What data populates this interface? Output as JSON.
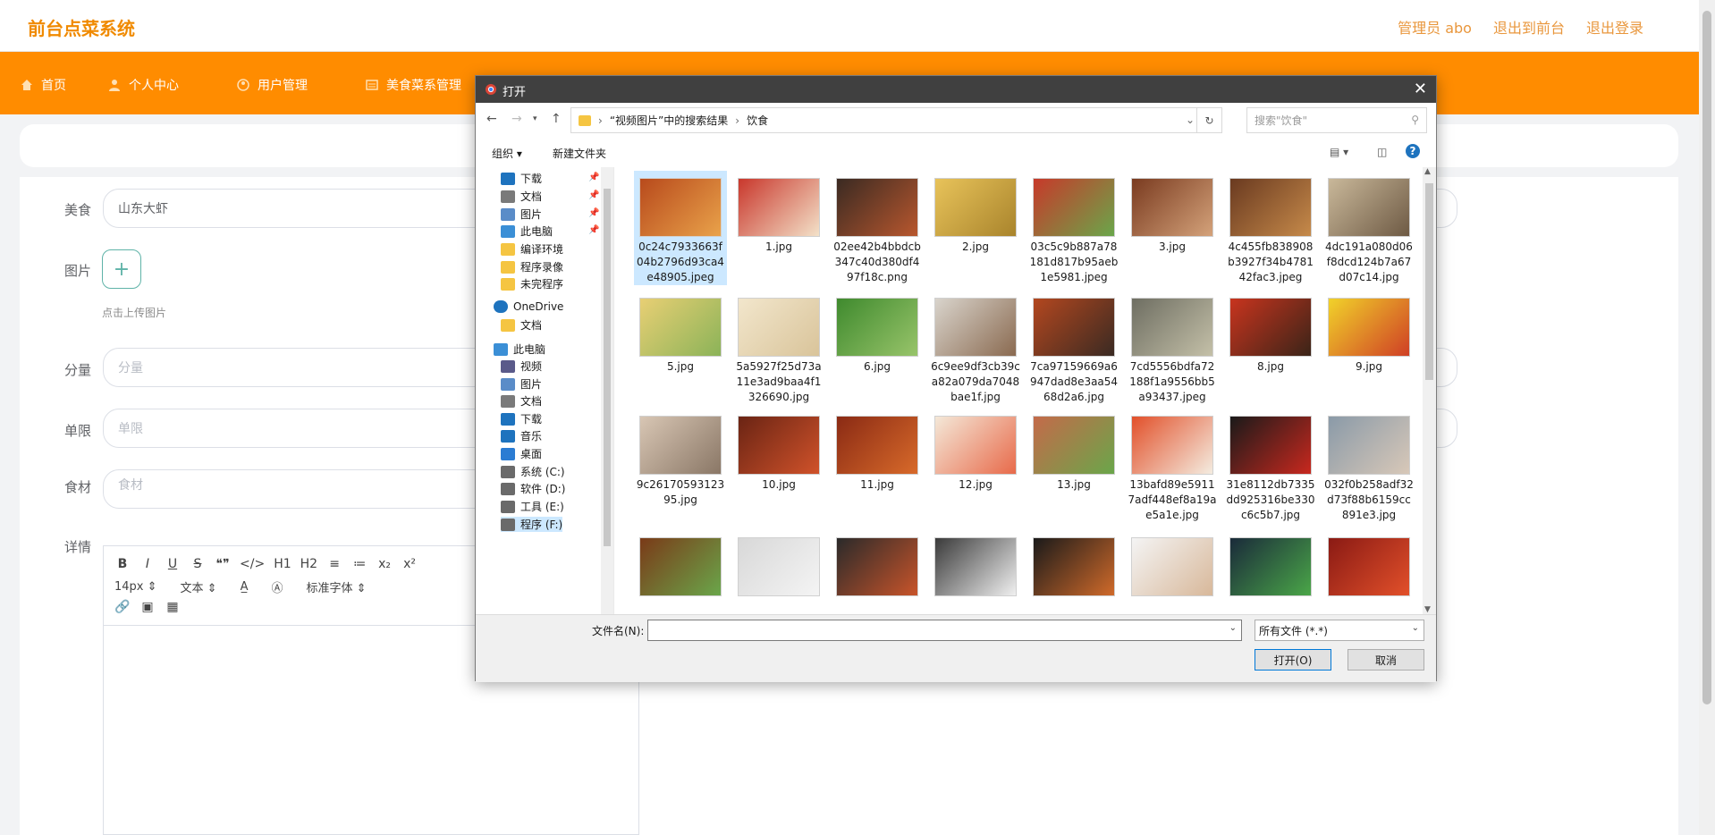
{
  "app": {
    "brand": "前台点菜系统",
    "top_links": {
      "admin": "管理员 abo",
      "back": "退出到前台",
      "logout": "退出登录"
    }
  },
  "nav": [
    {
      "label": "首页",
      "icon": "home-icon"
    },
    {
      "label": "个人中心",
      "icon": "user-icon"
    },
    {
      "label": "用户管理",
      "icon": "users-icon"
    },
    {
      "label": "美食菜系管理",
      "icon": "list-icon"
    }
  ],
  "form": {
    "food_label": "美食",
    "food_value": "山东大虾",
    "image_label": "图片",
    "upload_hint": "点击上传图片",
    "portion_label": "分量",
    "portion_placeholder": "分量",
    "limit_label": "单限",
    "limit_placeholder": "单限",
    "ingredient_label": "食材",
    "ingredient_placeholder": "食材",
    "detail_label": "详情"
  },
  "editor": {
    "toolbar_row1": [
      "B",
      "I",
      "U",
      "S",
      "❝❞",
      "</>",
      "H1",
      "H2",
      "≡",
      "≔",
      "x₂",
      "x²"
    ],
    "size": "14px",
    "text": "文本",
    "font": "标准字体"
  },
  "dialog": {
    "title": "打开",
    "breadcrumb": [
      "“视频图片”中的搜索结果",
      "饮食"
    ],
    "search_placeholder": "搜索\"饮食\"",
    "organize": "组织 ▾",
    "new_folder": "新建文件夹",
    "tree": [
      {
        "label": "下载",
        "icon": "download-icon",
        "pin": true
      },
      {
        "label": "文档",
        "icon": "document-icon",
        "pin": true
      },
      {
        "label": "图片",
        "icon": "picture-icon",
        "pin": true
      },
      {
        "label": "此电脑",
        "icon": "computer-icon",
        "pin": true
      },
      {
        "label": "编译环境",
        "icon": "folder-icon"
      },
      {
        "label": "程序录像",
        "icon": "folder-icon"
      },
      {
        "label": "未完程序",
        "icon": "folder-icon"
      },
      {
        "label": "OneDrive",
        "icon": "cloud-icon"
      },
      {
        "label": "文档",
        "icon": "folder-icon"
      },
      {
        "label": "此电脑",
        "icon": "computer-icon"
      },
      {
        "label": "视频",
        "icon": "video-icon"
      },
      {
        "label": "图片",
        "icon": "picture-icon"
      },
      {
        "label": "文档",
        "icon": "document-icon"
      },
      {
        "label": "下载",
        "icon": "download-icon"
      },
      {
        "label": "音乐",
        "icon": "music-icon"
      },
      {
        "label": "桌面",
        "icon": "desktop-icon"
      },
      {
        "label": "系统 (C:)",
        "icon": "drive-icon"
      },
      {
        "label": "软件 (D:)",
        "icon": "drive-icon"
      },
      {
        "label": "工具 (E:)",
        "icon": "drive-icon"
      },
      {
        "label": "程序 (F:)",
        "icon": "drive-icon"
      }
    ],
    "files": [
      {
        "name": "0c24c7933663f04b2796d93ca4e48905.jpeg",
        "c1": "#b84a1c",
        "c2": "#e9a24a"
      },
      {
        "name": "1.jpg",
        "c1": "#c9372c",
        "c2": "#f3e1c8"
      },
      {
        "name": "02ee42b4bbdcb347c40d380df497f18c.png",
        "c1": "#3a2a22",
        "c2": "#b8572e"
      },
      {
        "name": "2.jpg",
        "c1": "#e8c35a",
        "c2": "#a9842c"
      },
      {
        "name": "03c5c9b887a78181d817b95aeb1e5981.jpeg",
        "c1": "#c7392a",
        "c2": "#6aa64a"
      },
      {
        "name": "3.jpg",
        "c1": "#7a3b20",
        "c2": "#d4a27a"
      },
      {
        "name": "4c455fb838908b3927f34b478142fac3.jpeg",
        "c1": "#6a3a20",
        "c2": "#c68a4a"
      },
      {
        "name": "4dc191a080d06f8dcd124b7a67d07c14.jpg",
        "c1": "#c9b89a",
        "c2": "#6e5a44"
      },
      {
        "name": "5.jpg",
        "c1": "#e8cf74",
        "c2": "#8bb358"
      },
      {
        "name": "5a5927f25d73a11e3ad9baa4f1326690.jpg",
        "c1": "#f2e6cc",
        "c2": "#d9c49a"
      },
      {
        "name": "6.jpg",
        "c1": "#3f8a2e",
        "c2": "#98c46a"
      },
      {
        "name": "6c9ee9df3cb39ca82a079da7048bae1f.jpg",
        "c1": "#d9d4cc",
        "c2": "#8a6a50"
      },
      {
        "name": "7ca97159669a6947dad8e3aa5468d2a6.jpg",
        "c1": "#b3471f",
        "c2": "#3a2a22"
      },
      {
        "name": "7cd5556bdfa72188f1a9556bb5a93437.jpeg",
        "c1": "#6e6e62",
        "c2": "#c4c0a8"
      },
      {
        "name": "8.jpg",
        "c1": "#c8341e",
        "c2": "#3a2418"
      },
      {
        "name": "9.jpg",
        "c1": "#f1d22a",
        "c2": "#cf3f25"
      },
      {
        "name": "9c2617059312395.jpg",
        "c1": "#d8c6b4",
        "c2": "#8a7766"
      },
      {
        "name": "10.jpg",
        "c1": "#6a2414",
        "c2": "#d0522a"
      },
      {
        "name": "11.jpg",
        "c1": "#8a2a14",
        "c2": "#d86a2a"
      },
      {
        "name": "12.jpg",
        "c1": "#f4e8d8",
        "c2": "#e86a4a"
      },
      {
        "name": "13.jpg",
        "c1": "#c46a4a",
        "c2": "#6aa64a"
      },
      {
        "name": "13bafd89e59117adf448ef8a19ae5a1e.jpg",
        "c1": "#e2502a",
        "c2": "#f4ece0"
      },
      {
        "name": "31e8112db7335dd925316be330c6c5b7.jpg",
        "c1": "#1a1a1a",
        "c2": "#c8281e"
      },
      {
        "name": "032f0b258adf32d73f88b6159cc891e3.jpg",
        "c1": "#8a9aa8",
        "c2": "#d8c8b8"
      },
      {
        "name": "",
        "c1": "#7a3a18",
        "c2": "#6aa64a"
      },
      {
        "name": "",
        "c1": "#d8d8d8",
        "c2": "#f4f4f4"
      },
      {
        "name": "",
        "c1": "#2a2a2a",
        "c2": "#c8542a"
      },
      {
        "name": "",
        "c1": "#3a3a3a",
        "c2": "#f0f0f0"
      },
      {
        "name": "",
        "c1": "#1a1a1a",
        "c2": "#d06a2a"
      },
      {
        "name": "",
        "c1": "#f4f4f4",
        "c2": "#d8b89a"
      },
      {
        "name": "",
        "c1": "#1a2a3a",
        "c2": "#4aa648"
      },
      {
        "name": "",
        "c1": "#8a1a14",
        "c2": "#e2502a"
      }
    ],
    "filename_label": "文件名(N):",
    "filetype": "所有文件 (*.*)",
    "open": "打开(O)",
    "cancel": "取消"
  },
  "colors": {
    "accent": "#ff8c00",
    "brand": "#f08a00",
    "link": "#e9973d",
    "selection": "#cce8ff"
  }
}
